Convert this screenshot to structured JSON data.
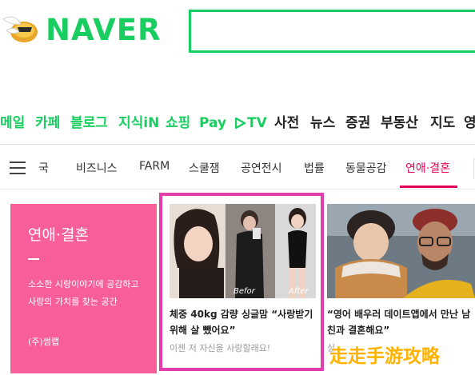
{
  "header": {
    "logo": "NAVER",
    "search": {
      "value": ""
    }
  },
  "service_nav": [
    {
      "label": "메일",
      "style": "green"
    },
    {
      "label": "카페",
      "style": "green"
    },
    {
      "label": "블로그",
      "style": "green"
    },
    {
      "label": "지식iN",
      "style": "green"
    },
    {
      "label": "쇼핑",
      "style": "green"
    },
    {
      "label": "Pay",
      "style": "green"
    },
    {
      "label": "TV",
      "style": "green"
    },
    {
      "label": "사전",
      "style": "dark"
    },
    {
      "label": "뉴스",
      "style": "dark"
    },
    {
      "label": "증권",
      "style": "dark"
    },
    {
      "label": "부동산",
      "style": "dark"
    },
    {
      "label": "지도",
      "style": "dark"
    },
    {
      "label": "영",
      "style": "dark"
    }
  ],
  "category_tabs": {
    "items": [
      "국",
      "비즈니스",
      "FARM",
      "스쿨잼",
      "공연전시",
      "법률",
      "동물공감",
      "연애·결혼"
    ],
    "active": "연애·결혼"
  },
  "promo": {
    "title": "연애·결혼",
    "description": "소소한 시랑이야기에 공감하고 사랑의 가치를 찾는 공간",
    "source": "(주)썸랩"
  },
  "articles": [
    {
      "title": "체중 40kg 감량 싱글맘 “사랑받기 위해 살 뺐어요”",
      "subtitle": "이젠 저 자신을 사랑할래요!",
      "before_label": "Befor",
      "after_label": "After"
    },
    {
      "title": "“영어 배우러 데이트앱에서 만난 남친과 결혼해요”",
      "subtitle": "실"
    }
  ],
  "watermark": "走走手游攻略",
  "colors": {
    "brand": "#19ce60",
    "active_tab": "#e4005a",
    "promo_bg": "#f75e9a",
    "highlight": "#e23dac"
  }
}
